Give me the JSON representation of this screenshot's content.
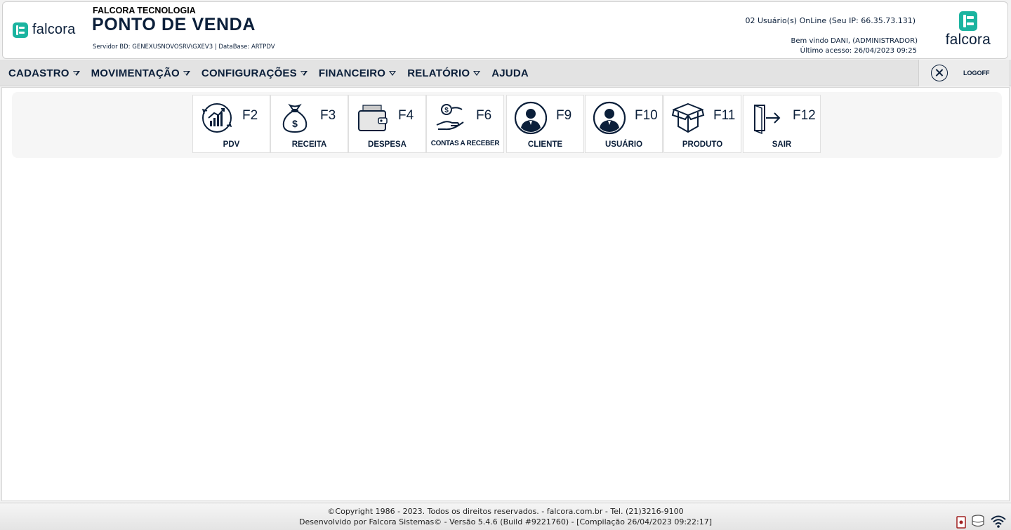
{
  "header": {
    "brand": "falcora",
    "company": "FALCORA TECNOLOGIA",
    "system_title": "PONTO DE VENDA",
    "server_info": "Servidor BD: GENEXUSNOVOSRV\\GXEV3 | DataBase: ARTPDV",
    "online_users": "02 Usuário(s) OnLine (Seu IP: 66.35.73.131)",
    "welcome": "Bem vindo DANI, (ADMINISTRADOR)",
    "last_access": "Último acesso: 26/04/2023 09:25"
  },
  "menu": {
    "items": [
      {
        "label": "CADASTRO",
        "has_dropdown": true
      },
      {
        "label": "MOVIMENTAÇÃO",
        "has_dropdown": true
      },
      {
        "label": "CONFIGURAÇÕES",
        "has_dropdown": true
      },
      {
        "label": "FINANCEIRO",
        "has_dropdown": true
      },
      {
        "label": "RELATÓRIO",
        "has_dropdown": true
      },
      {
        "label": "AJUDA",
        "has_dropdown": false
      }
    ],
    "logoff_label": "LOGOFF"
  },
  "shortcuts": [
    {
      "key": "F2",
      "label": "PDV",
      "icon": "sales-chart-icon"
    },
    {
      "key": "F3",
      "label": "RECEITA",
      "icon": "money-bag-icon"
    },
    {
      "key": "F4",
      "label": "DESPESA",
      "icon": "wallet-icon"
    },
    {
      "key": "F6",
      "label": "CONTAS A RECEBER",
      "icon": "hand-coin-icon"
    },
    {
      "key": "F9",
      "label": "CLIENTE",
      "icon": "user-avatar-icon"
    },
    {
      "key": "F10",
      "label": "USUÁRIO",
      "icon": "user-avatar-icon"
    },
    {
      "key": "F11",
      "label": "PRODUTO",
      "icon": "box-icon"
    },
    {
      "key": "F12",
      "label": "SAIR",
      "icon": "exit-door-icon"
    }
  ],
  "footer": {
    "copyright": "©Copyright 1986 - 2023. Todos os direitos reservados. - falcora.com.br - Tel. (21)3216-9100",
    "build": "Desenvolvido por Falcora Sistemas© - Versão 5.4.6 (Build #9221760) - [Compilação 26/04/2023 09:22:17]"
  },
  "colors": {
    "brand_teal": "#1bb4a0",
    "navy": "#0b1f3a",
    "menubar": "#e3e3e3"
  }
}
